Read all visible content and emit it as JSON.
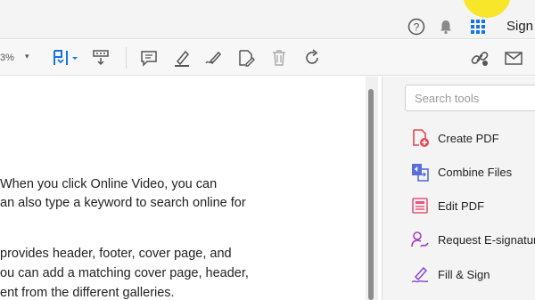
{
  "titlebar": {
    "sign_label": "Sign"
  },
  "toolbar": {
    "zoom_value": "3%"
  },
  "document": {
    "lines": [
      "When you click Online Video, you can",
      "an also type a keyword to search online for",
      "provides header, footer, cover page, and",
      "ou can add a matching cover page, header,",
      "ent from the different galleries."
    ]
  },
  "tools_pane": {
    "search_placeholder": "Search tools",
    "items": [
      {
        "label": "Create PDF",
        "icon": "create-pdf-icon"
      },
      {
        "label": "Combine Files",
        "icon": "combine-files-icon"
      },
      {
        "label": "Edit PDF",
        "icon": "edit-pdf-icon"
      },
      {
        "label": "Request E-signatures",
        "icon": "request-esign-icon"
      },
      {
        "label": "Fill & Sign",
        "icon": "fill-sign-icon"
      }
    ]
  },
  "colors": {
    "accent_blue": "#1473e6",
    "accent_red": "#e34850",
    "accent_purple": "#8c4fd8",
    "highlight_yellow": "#f7e62a"
  }
}
